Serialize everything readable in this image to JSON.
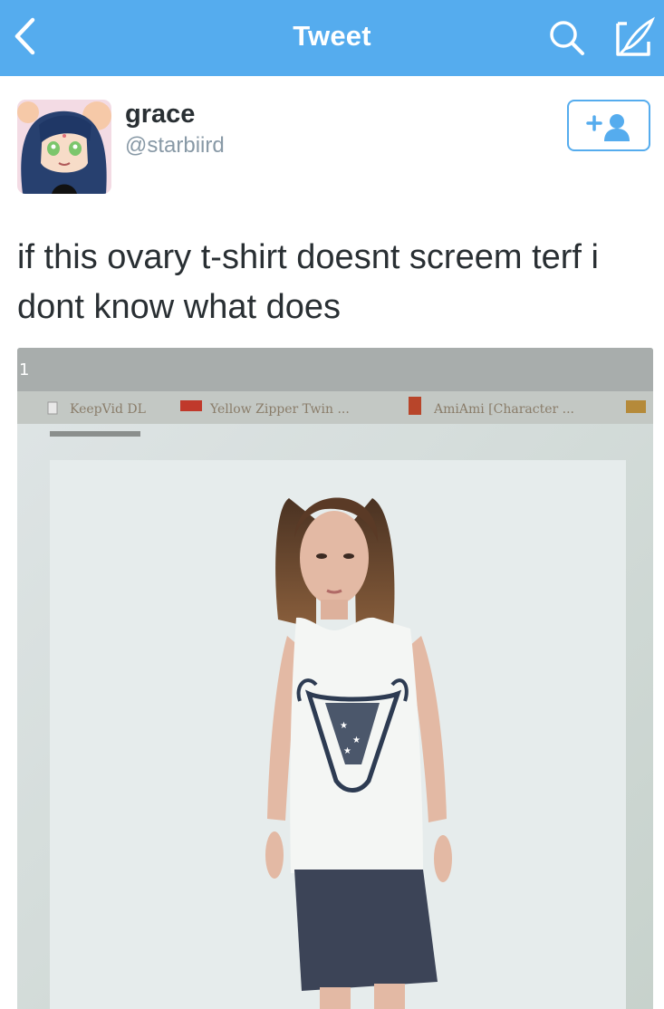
{
  "nav": {
    "title": "Tweet",
    "back_icon": "chevron-left-icon",
    "search_icon": "search-icon",
    "compose_icon": "compose-icon",
    "bar_color": "#55acee"
  },
  "user": {
    "display_name": "grace",
    "handle": "@starbiird",
    "follow_icon": "add-user-icon"
  },
  "tweet": {
    "text": "if this ovary t-shirt doesnt screem terf i dont know what does"
  },
  "photo": {
    "tab_number": "1",
    "bookmarks": [
      {
        "label": "KeepVid DL"
      },
      {
        "label": "Yellow Zipper Twin ..."
      },
      {
        "label": "AmiAmi [Character ..."
      }
    ]
  }
}
